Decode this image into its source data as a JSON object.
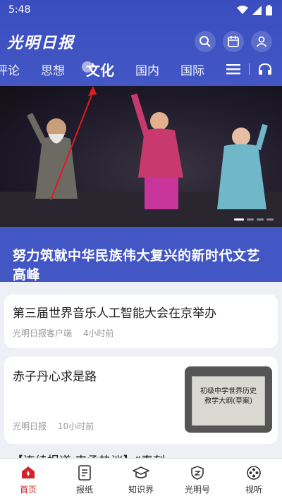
{
  "status_bar": {
    "time": "5:48"
  },
  "header": {
    "logo": "光明日报"
  },
  "nav": {
    "tabs": [
      {
        "label": "评论"
      },
      {
        "label": "思想"
      },
      {
        "label": "文化",
        "active": true
      },
      {
        "label": "国内"
      },
      {
        "label": "国际"
      }
    ]
  },
  "hero": {
    "caption": "努力筑就中华民族伟大复兴的新时代文艺高峰"
  },
  "articles": [
    {
      "title": "第三届世界音乐人工智能大会在京举办",
      "source": "光明日报客户端",
      "time": "4小时前"
    },
    {
      "title": "赤子丹心求是路",
      "source": "光明日报",
      "time": "10小时前",
      "thumb_line1": "初级中学世界历史",
      "thumb_line2": "教学大纲(草案)"
    },
    {
      "title": "【连续报道·来函热议】“春刻"
    }
  ],
  "bottom_nav": {
    "items": [
      {
        "label": "首页",
        "active": true
      },
      {
        "label": "报纸"
      },
      {
        "label": "知识界"
      },
      {
        "label": "光明号"
      },
      {
        "label": "视听"
      }
    ]
  },
  "colors": {
    "brand_blue": "#4256c4",
    "active_red": "#d2232a"
  }
}
